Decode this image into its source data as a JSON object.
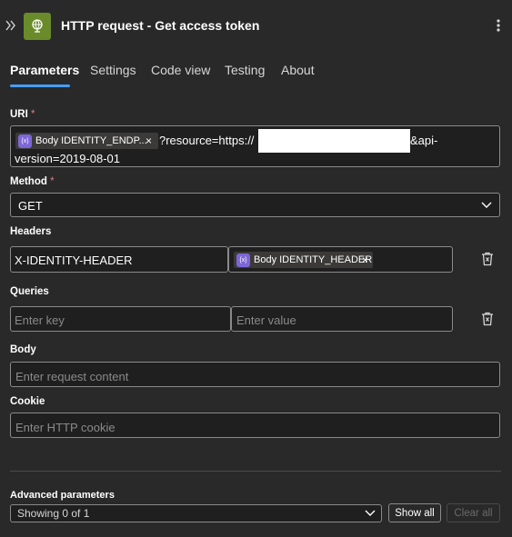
{
  "header": {
    "title": "HTTP request - Get access token",
    "collapse_icon": "double-chevron-right-icon",
    "app_icon": "globe-icon",
    "more_icon": "vertical-ellipsis-icon"
  },
  "tabs": [
    {
      "label": "Parameters",
      "active": true
    },
    {
      "label": "Settings"
    },
    {
      "label": "Code view"
    },
    {
      "label": "Testing"
    },
    {
      "label": "About"
    }
  ],
  "uri": {
    "label": "URI",
    "required_mark": "*",
    "token_label": "Body IDENTITY_ENDP...",
    "token_remove": "×",
    "text_part1": "?resource=https://",
    "text_part2": "&api-",
    "text_line2": "version=2019-08-01"
  },
  "method": {
    "label": "Method",
    "required_mark": "*",
    "value": "GET"
  },
  "headers": {
    "label": "Headers",
    "key": "X-IDENTITY-HEADER",
    "token_label": "Body IDENTITY_HEADER",
    "token_remove": "×"
  },
  "queries": {
    "label": "Queries",
    "key_placeholder": "Enter key",
    "value_placeholder": "Enter value"
  },
  "body": {
    "label": "Body",
    "placeholder": "Enter request content"
  },
  "cookie": {
    "label": "Cookie",
    "placeholder": "Enter HTTP cookie"
  },
  "advanced": {
    "label": "Advanced parameters",
    "select_value": "Showing 0 of 1",
    "show_all": "Show all",
    "clear_all": "Clear all"
  },
  "colors": {
    "background": "#292929",
    "accent": "#479ef5",
    "app_icon": "#6a8b2a",
    "token_icon": "#7c66d8"
  }
}
